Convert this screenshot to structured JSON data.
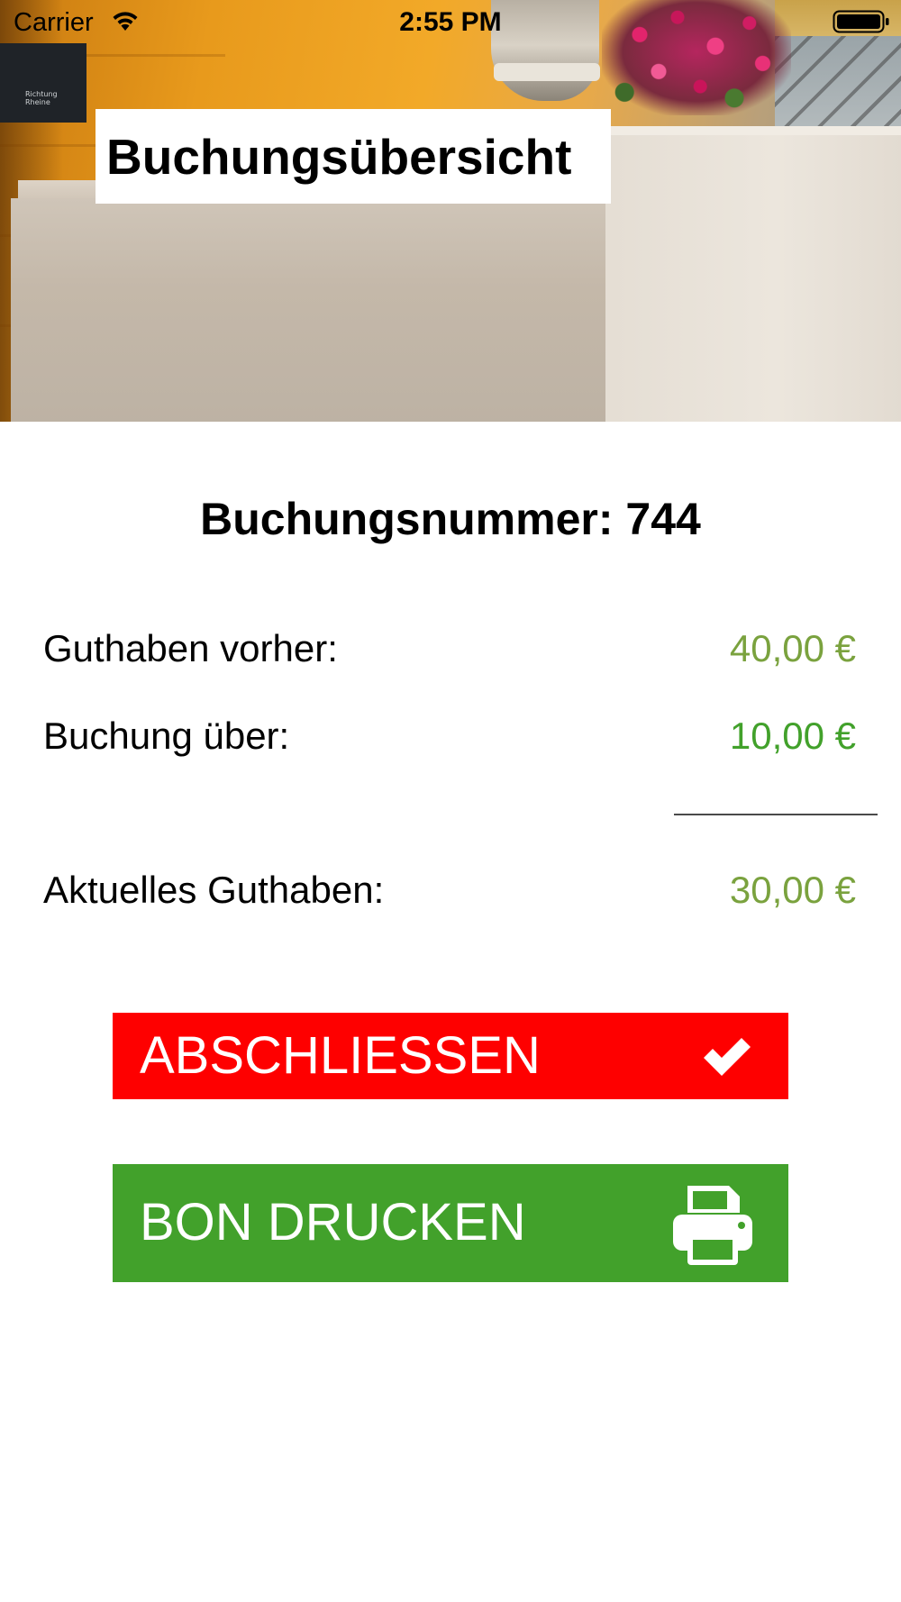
{
  "status_bar": {
    "carrier": "Carrier",
    "time": "2:55 PM",
    "wifi_icon": "wifi-icon",
    "battery_icon": "battery-full-icon"
  },
  "hero": {
    "title": "Buchungsübersicht",
    "sign_text": "Richtung Rheine"
  },
  "summary": {
    "booking_number_label": "Buchungsnummer:",
    "booking_number": "744",
    "balance_before_label": "Guthaben vorher:",
    "balance_before_value": "40,00 €",
    "booking_amount_label": "Buchung über:",
    "booking_amount_value": "10,00 €",
    "current_balance_label": "Aktuelles Guthaben:",
    "current_balance_value": "30,00 €"
  },
  "actions": {
    "close_label": "ABSCHLIESSEN",
    "close_icon": "checkmark-icon",
    "print_label": "BON DRUCKEN",
    "print_icon": "printer-icon"
  },
  "colors": {
    "close_button": "#fe0000",
    "print_button": "#42a12b",
    "value_before": "#7aa23e",
    "value_booking": "#42a12b",
    "value_current": "#7aa23e"
  }
}
